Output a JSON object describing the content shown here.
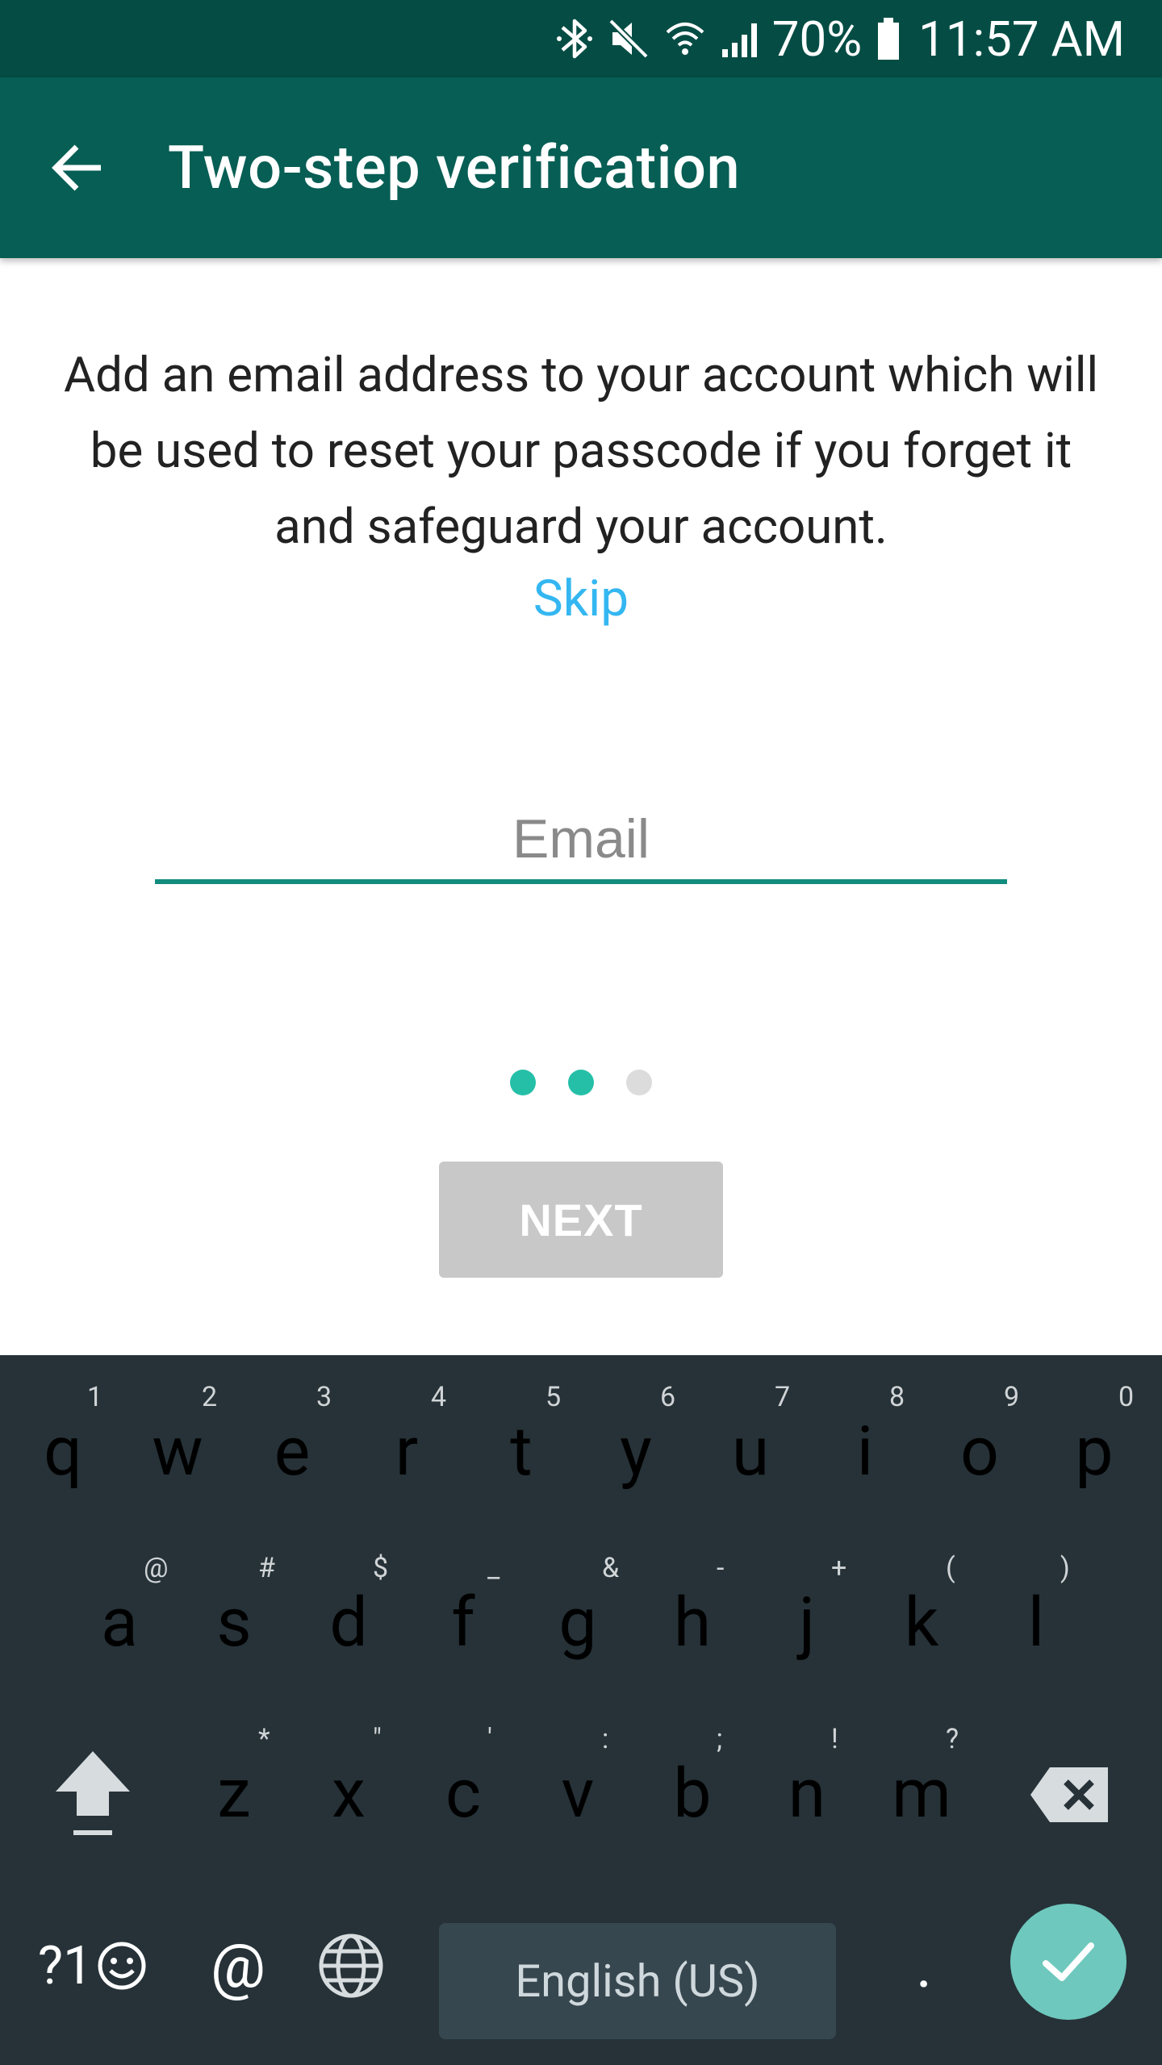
{
  "status_bar": {
    "battery_percent": "70%",
    "time": "11:57 AM",
    "icons": [
      "bluetooth-icon",
      "mute-icon",
      "wifi-icon",
      "signal-icon",
      "battery-icon"
    ]
  },
  "app_bar": {
    "title": "Two-step verification",
    "back_icon": "arrow-back-icon",
    "background_color": "#075e54"
  },
  "content": {
    "description": "Add an email address to your account which will be used to reset your passcode if you forget it and safeguard your account.",
    "skip_label": "Skip",
    "email_placeholder": "Email",
    "email_value": "",
    "step_current": 2,
    "step_total": 3,
    "next_label": "NEXT",
    "next_enabled": false
  },
  "colors": {
    "accent": "#128c7e",
    "dot_active": "#25bfa8",
    "dot_inactive": "#dcdcdc",
    "link": "#34b7f1",
    "keyboard_bg": "#263238"
  },
  "keyboard": {
    "row1": [
      {
        "key": "q",
        "hint": "1"
      },
      {
        "key": "w",
        "hint": "2"
      },
      {
        "key": "e",
        "hint": "3"
      },
      {
        "key": "r",
        "hint": "4"
      },
      {
        "key": "t",
        "hint": "5"
      },
      {
        "key": "y",
        "hint": "6"
      },
      {
        "key": "u",
        "hint": "7"
      },
      {
        "key": "i",
        "hint": "8"
      },
      {
        "key": "o",
        "hint": "9"
      },
      {
        "key": "p",
        "hint": "0"
      }
    ],
    "row2": [
      {
        "key": "a",
        "hint": "@"
      },
      {
        "key": "s",
        "hint": "#"
      },
      {
        "key": "d",
        "hint": "$"
      },
      {
        "key": "f",
        "hint": "_"
      },
      {
        "key": "g",
        "hint": "&"
      },
      {
        "key": "h",
        "hint": "-"
      },
      {
        "key": "j",
        "hint": "+"
      },
      {
        "key": "k",
        "hint": "("
      },
      {
        "key": "l",
        "hint": ")"
      }
    ],
    "row3": [
      {
        "key": "z",
        "hint": "*"
      },
      {
        "key": "x",
        "hint": "\""
      },
      {
        "key": "c",
        "hint": "'"
      },
      {
        "key": "v",
        "hint": ":"
      },
      {
        "key": "b",
        "hint": ";"
      },
      {
        "key": "n",
        "hint": "!"
      },
      {
        "key": "m",
        "hint": "?"
      }
    ],
    "symbols_label": "?1",
    "at_key": "@",
    "space_label": "English (US)",
    "period_key": ".",
    "shift_icon": "shift-icon",
    "backspace_icon": "backspace-icon",
    "emoji_icon": "emoji-icon",
    "globe_icon": "globe-icon",
    "done_icon": "checkmark-icon"
  }
}
